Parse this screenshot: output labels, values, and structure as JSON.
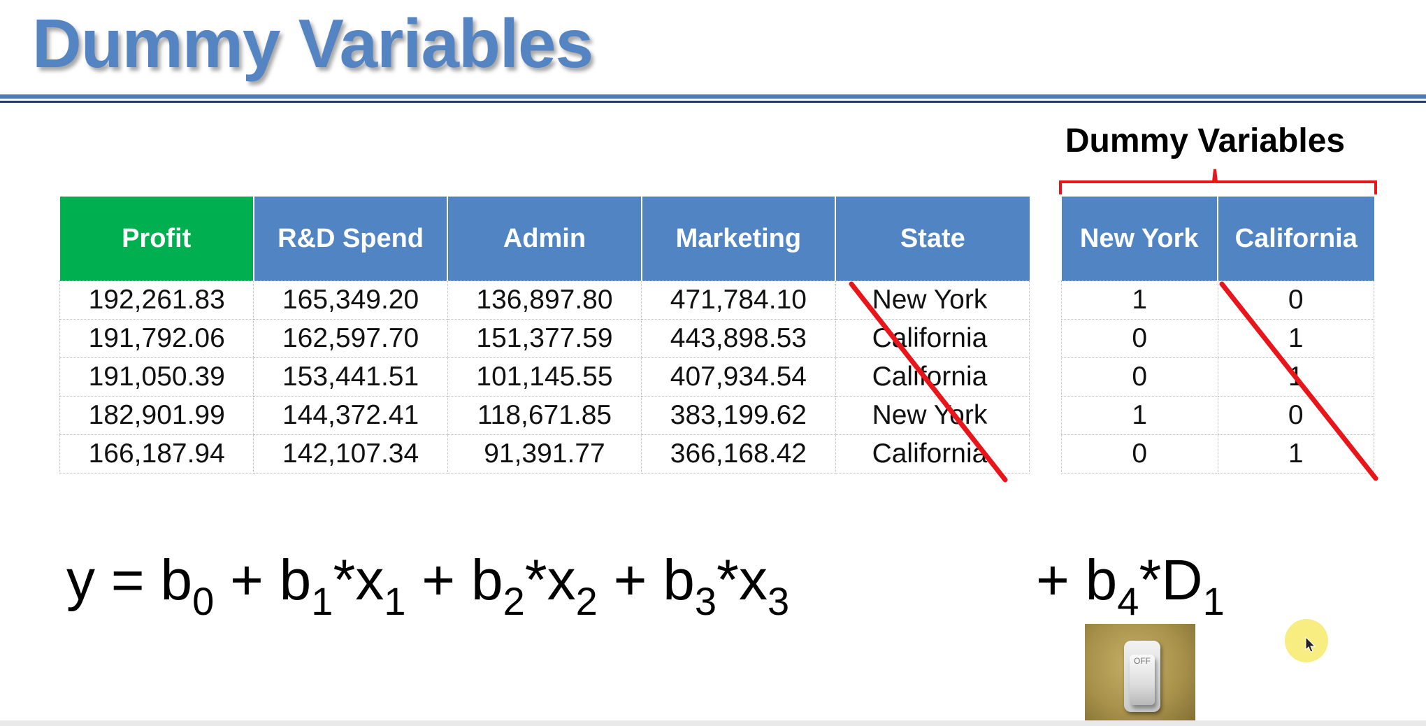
{
  "slide": {
    "title": "Dummy Variables",
    "dummy_group_label": "Dummy Variables"
  },
  "main_table": {
    "columns": [
      "Profit",
      "R&D Spend",
      "Admin",
      "Marketing",
      "State"
    ],
    "rows": [
      [
        "192,261.83",
        "165,349.20",
        "136,897.80",
        "471,784.10",
        "New York"
      ],
      [
        "191,792.06",
        "162,597.70",
        "151,377.59",
        "443,898.53",
        "California"
      ],
      [
        "191,050.39",
        "153,441.51",
        "101,145.55",
        "407,934.54",
        "California"
      ],
      [
        "182,901.99",
        "144,372.41",
        "118,671.85",
        "383,199.62",
        "New York"
      ],
      [
        "166,187.94",
        "142,107.34",
        "91,391.77",
        "366,168.42",
        "California"
      ]
    ]
  },
  "dummy_table": {
    "columns": [
      "New York",
      "California"
    ],
    "rows": [
      [
        "1",
        "0"
      ],
      [
        "0",
        "1"
      ],
      [
        "0",
        "1"
      ],
      [
        "1",
        "0"
      ],
      [
        "0",
        "1"
      ]
    ]
  },
  "equation": {
    "y": "y",
    "equals": " = ",
    "plus": " + ",
    "terms": [
      {
        "coef": "b",
        "coef_sub": "0"
      },
      {
        "coef": "b",
        "coef_sub": "1",
        "var": "x",
        "var_sub": "1"
      },
      {
        "coef": "b",
        "coef_sub": "2",
        "var": "x",
        "var_sub": "2"
      },
      {
        "coef": "b",
        "coef_sub": "3",
        "var": "x",
        "var_sub": "3"
      },
      {
        "coef": "b",
        "coef_sub": "4",
        "var": "D",
        "var_sub": "1"
      }
    ],
    "times": "*"
  },
  "switch": {
    "label": "OFF"
  },
  "colors": {
    "title": "#5484c2",
    "header_blue": "#5184c2",
    "header_green": "#00b050",
    "strike_red": "#e8161b",
    "rule": "#4a78b8",
    "cursor_halo": "#f7ec7a"
  }
}
